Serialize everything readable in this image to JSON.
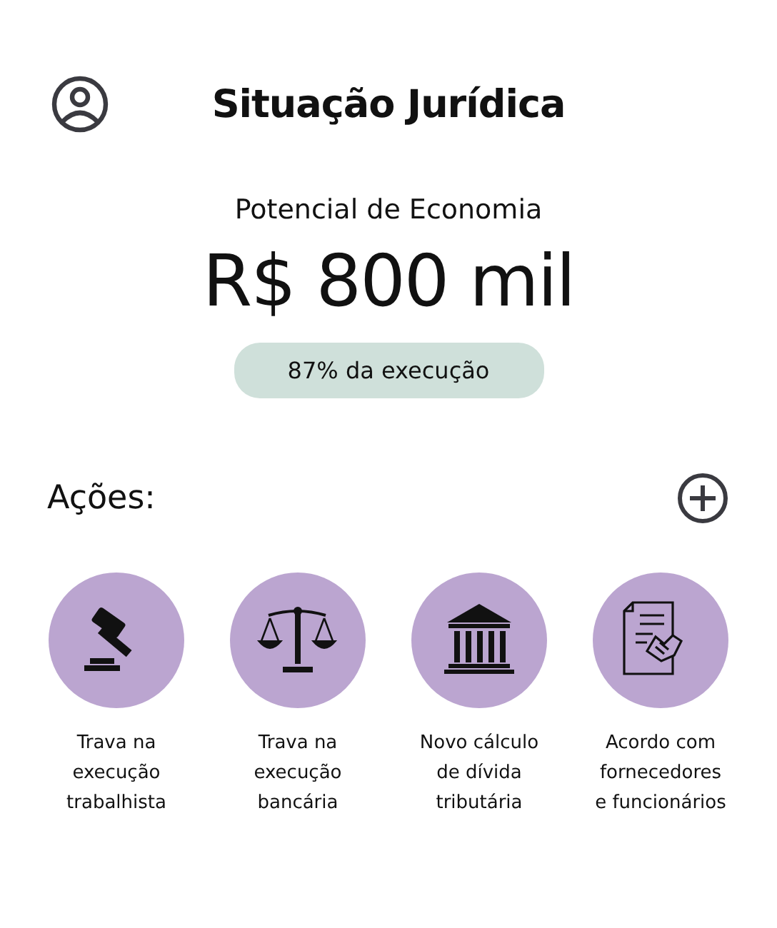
{
  "header": {
    "title": "Situação Jurídica"
  },
  "savings": {
    "label": "Potencial de Economia",
    "amount": "R$ 800 mil",
    "badge": "87% da execução"
  },
  "actions": {
    "title": "Ações:",
    "items": [
      {
        "kind": "gavel",
        "lines": [
          "Trava na",
          "execução",
          "trabalhista"
        ]
      },
      {
        "kind": "scales",
        "lines": [
          "Trava na",
          "execução",
          "bancária"
        ]
      },
      {
        "kind": "courthouse",
        "lines": [
          "Novo cálculo",
          "de dívida",
          "tributária"
        ]
      },
      {
        "kind": "handshake",
        "lines": [
          "Acordo com",
          "fornecedores",
          "e funcionários"
        ]
      }
    ]
  }
}
